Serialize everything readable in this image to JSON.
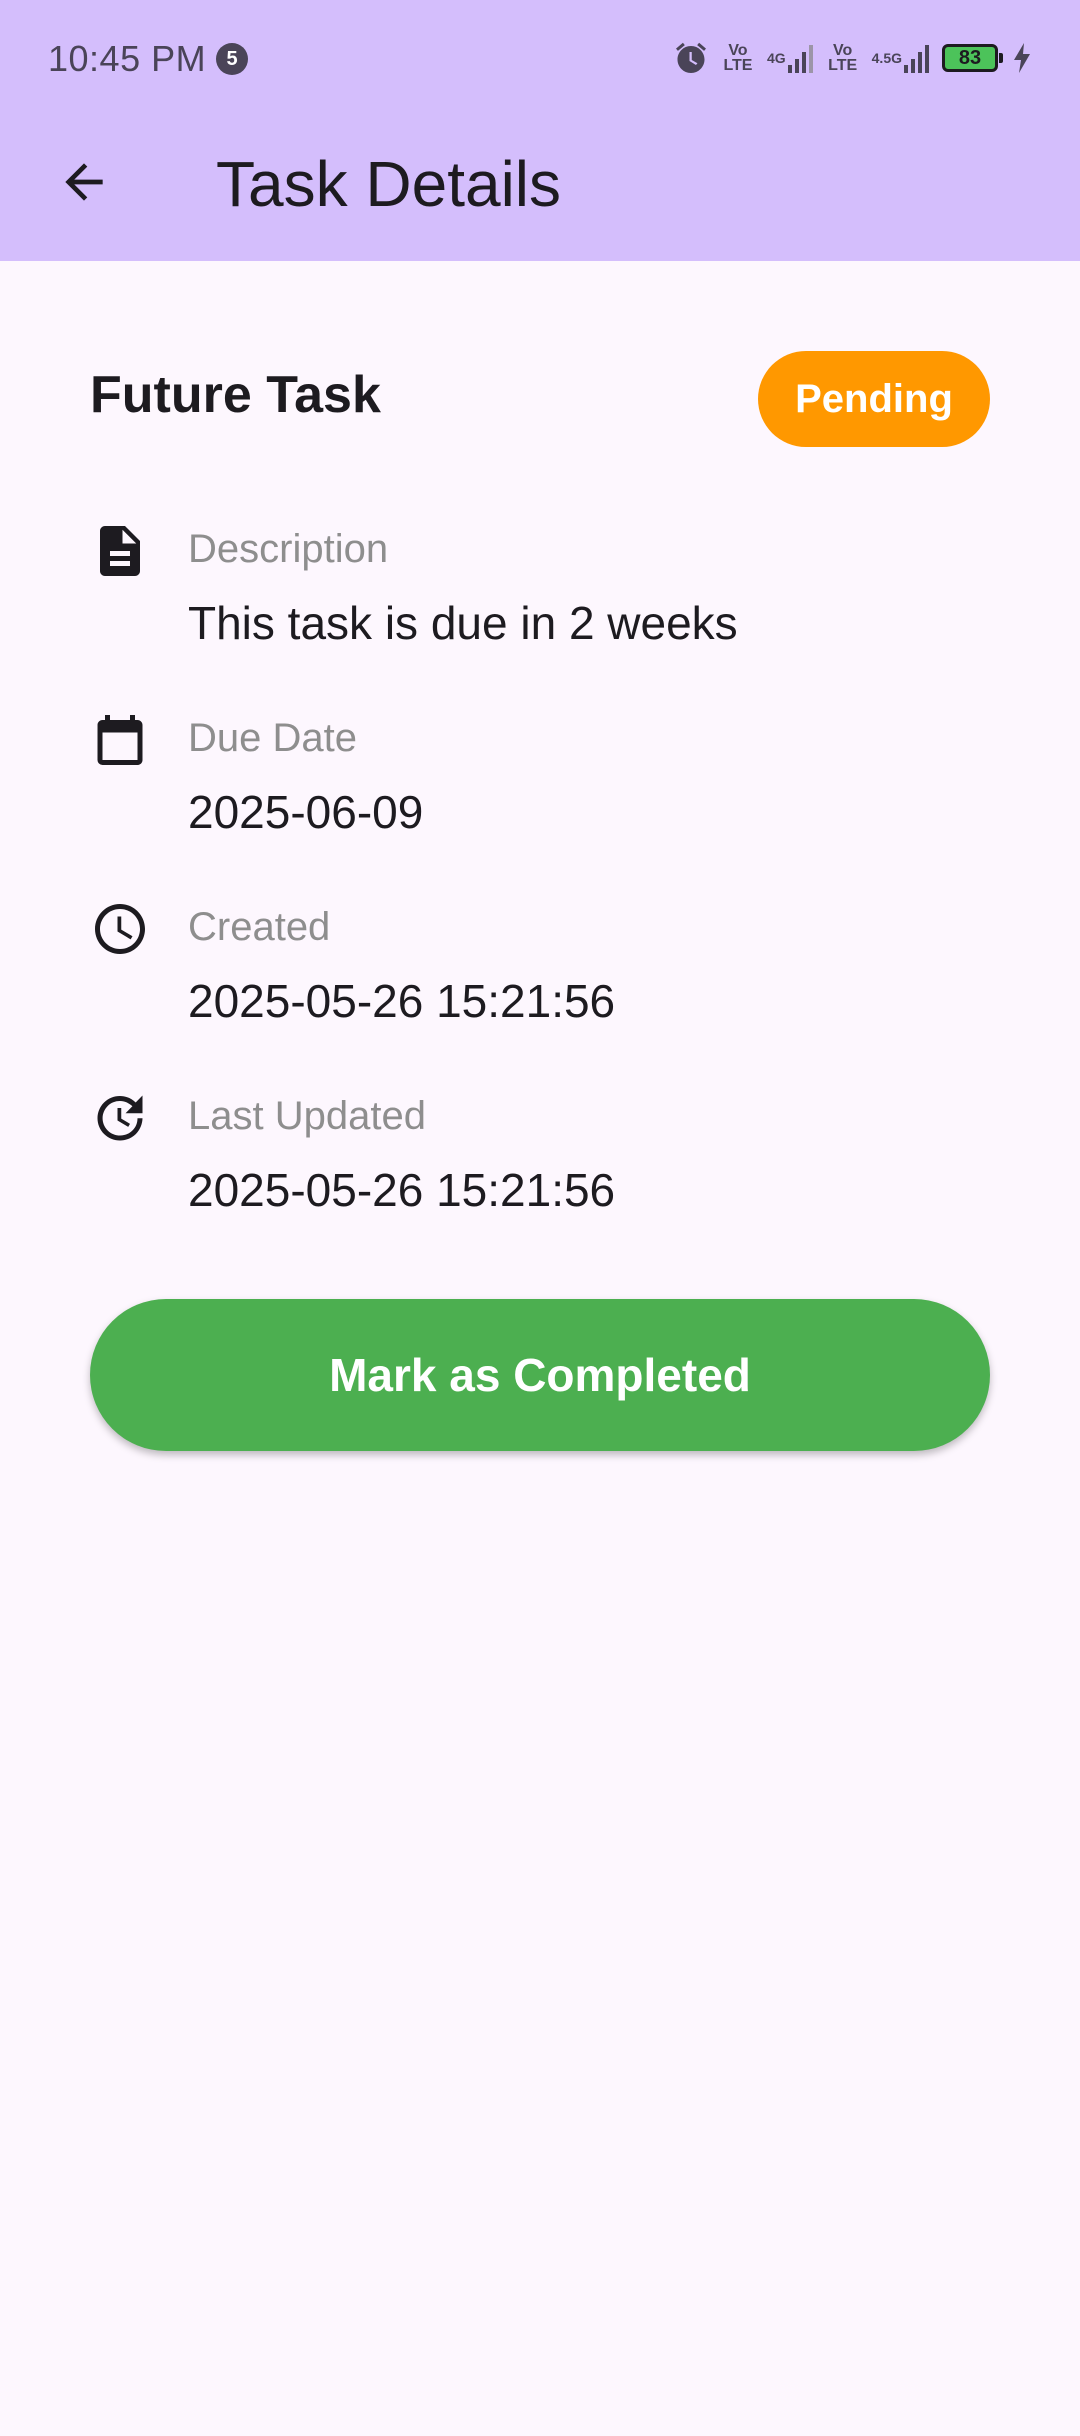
{
  "status_bar": {
    "time": "10:45 PM",
    "notification_count": "5",
    "network_labels": [
      "Vo LTE",
      "4G",
      "Vo LTE",
      "4.5G"
    ],
    "battery_level": "83",
    "icons": [
      "alarm-icon",
      "signal-icon",
      "signal-icon",
      "battery-icon",
      "charging-icon"
    ]
  },
  "app_bar": {
    "title": "Task Details",
    "back_icon": "arrow-back-icon"
  },
  "task": {
    "title": "Future Task",
    "status": "Pending",
    "status_color": "#FF9800"
  },
  "details": [
    {
      "label": "Description",
      "value": "This task is due in 2 weeks",
      "icon": "description-icon"
    },
    {
      "label": "Due Date",
      "value": "2025-06-09",
      "icon": "calendar-icon"
    },
    {
      "label": "Created",
      "value": "2025-05-26 15:21:56",
      "icon": "clock-icon"
    },
    {
      "label": "Last Updated",
      "value": "2025-05-26 15:21:56",
      "icon": "update-icon"
    }
  ],
  "actions": {
    "complete_label": "Mark as Completed",
    "complete_color": "#4CAF50"
  },
  "colors": {
    "app_bar": "#D4BEFC",
    "background": "#FDF7FE"
  }
}
